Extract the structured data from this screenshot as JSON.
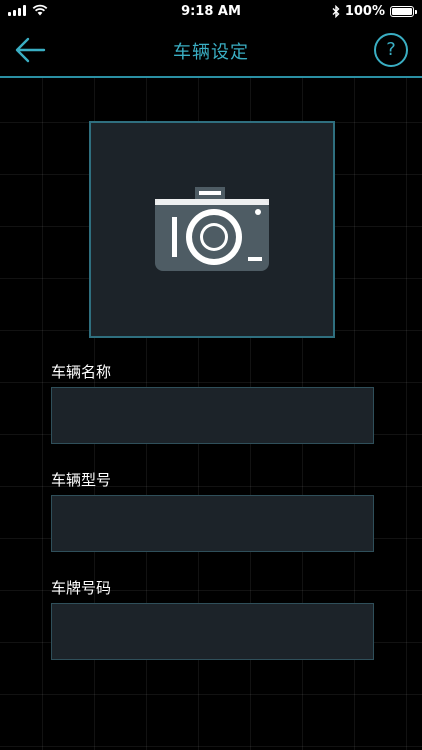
{
  "status_bar": {
    "time": "9:18 AM",
    "battery": "100%",
    "battery_level": 1.0,
    "icons": [
      "signal-icon",
      "wifi-icon",
      "bluetooth-icon",
      "battery-icon"
    ]
  },
  "nav": {
    "title": "车辆设定",
    "back_icon": "back-arrow-icon",
    "help_label": "?"
  },
  "photo": {
    "icon": "camera-icon"
  },
  "fields": [
    {
      "label": "车辆名称",
      "value": "",
      "placeholder": ""
    },
    {
      "label": "车辆型号",
      "value": "",
      "placeholder": ""
    },
    {
      "label": "车牌号码",
      "value": "",
      "placeholder": ""
    }
  ],
  "colors": {
    "accent": "#3aaec3",
    "background": "#000000",
    "panel": "#1c2329",
    "camera": "#4e5c64"
  }
}
